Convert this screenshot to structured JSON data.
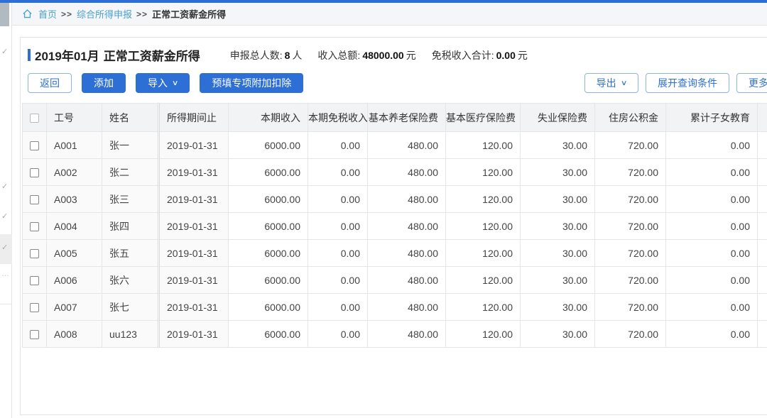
{
  "breadcrumb": {
    "home": "首页",
    "sep": ">>",
    "items": [
      "综合所得申报",
      "正常工资薪金所得"
    ]
  },
  "header": {
    "title_period": "2019年01月",
    "title_name": "正常工资薪金所得",
    "stats": [
      {
        "label": "申报总人数:",
        "value": "8",
        "unit": "人"
      },
      {
        "label": "收入总额:",
        "value": "48000.00",
        "unit": "元"
      },
      {
        "label": "免税收入合计:",
        "value": "0.00",
        "unit": "元"
      }
    ]
  },
  "toolbar": {
    "back": "返回",
    "add": "添加",
    "import": "导入",
    "prefill": "预填专项附加扣除",
    "export": "导出",
    "expand_query": "展开查询条件",
    "more": "更多操作",
    "chevron_icon": "∨"
  },
  "sidebar": {
    "collapsed_marks": "✓",
    "ellipsis": "…"
  },
  "table": {
    "columns": [
      "工号",
      "姓名",
      "所得期间止",
      "本期收入",
      "本期免税收入",
      "基本养老保险费",
      "基本医疗保险费",
      "失业保险费",
      "住房公积金",
      "累计子女教育"
    ],
    "rows": [
      [
        "A001",
        "张一",
        "2019-01-31",
        "6000.00",
        "0.00",
        "480.00",
        "120.00",
        "30.00",
        "720.00",
        "0.00"
      ],
      [
        "A002",
        "张二",
        "2019-01-31",
        "6000.00",
        "0.00",
        "480.00",
        "120.00",
        "30.00",
        "720.00",
        "0.00"
      ],
      [
        "A003",
        "张三",
        "2019-01-31",
        "6000.00",
        "0.00",
        "480.00",
        "120.00",
        "30.00",
        "720.00",
        "0.00"
      ],
      [
        "A004",
        "张四",
        "2019-01-31",
        "6000.00",
        "0.00",
        "480.00",
        "120.00",
        "30.00",
        "720.00",
        "0.00"
      ],
      [
        "A005",
        "张五",
        "2019-01-31",
        "6000.00",
        "0.00",
        "480.00",
        "120.00",
        "30.00",
        "720.00",
        "0.00"
      ],
      [
        "A006",
        "张六",
        "2019-01-31",
        "6000.00",
        "0.00",
        "480.00",
        "120.00",
        "30.00",
        "720.00",
        "0.00"
      ],
      [
        "A007",
        "张七",
        "2019-01-31",
        "6000.00",
        "0.00",
        "480.00",
        "120.00",
        "30.00",
        "720.00",
        "0.00"
      ],
      [
        "A008",
        "uu123",
        "2019-01-31",
        "6000.00",
        "0.00",
        "480.00",
        "120.00",
        "30.00",
        "720.00",
        "0.00"
      ]
    ]
  },
  "colors": {
    "accent": "#2e6fd6",
    "link": "#4aa0cc",
    "header_bg": "#f2f3f5"
  }
}
